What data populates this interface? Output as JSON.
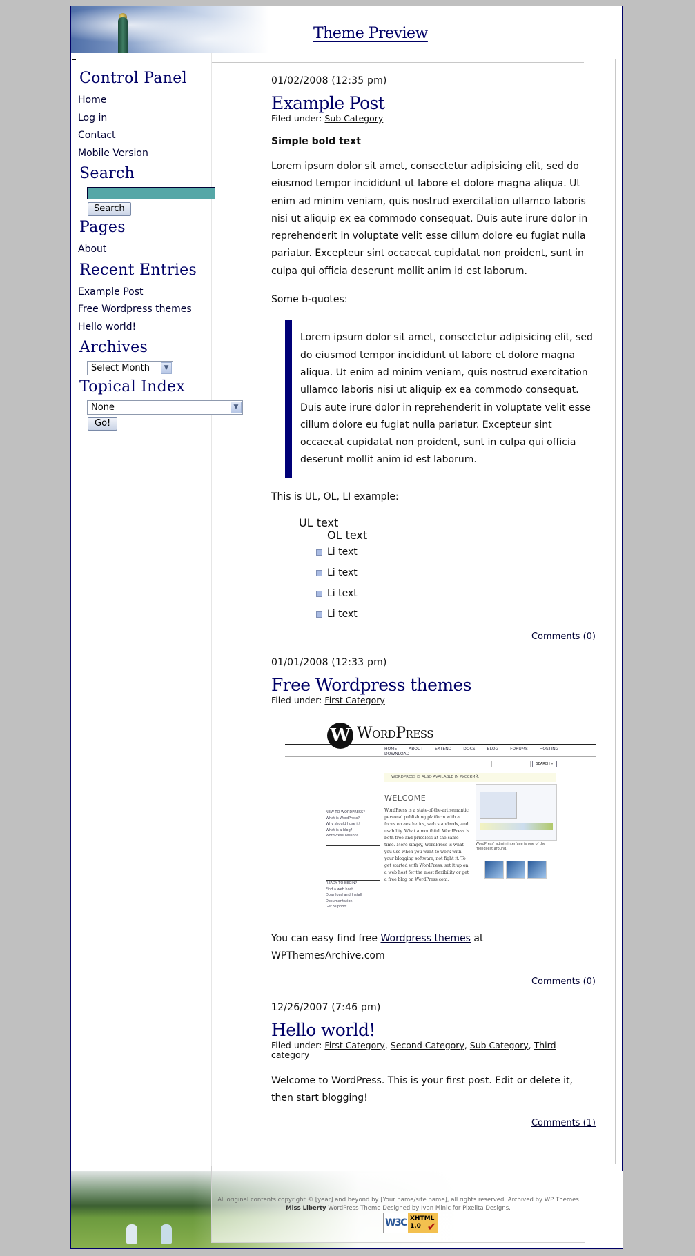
{
  "header": {
    "site_title": "Theme Preview"
  },
  "sidebar": {
    "control_panel": {
      "heading": "Control Panel",
      "links": [
        "Home",
        "Log in",
        "Contact",
        "Mobile Version"
      ]
    },
    "search": {
      "heading": "Search",
      "input_value": "",
      "button_label": "Search"
    },
    "pages": {
      "heading": "Pages",
      "links": [
        "About"
      ]
    },
    "recent_entries": {
      "heading": "Recent Entries",
      "links": [
        "Example Post",
        "Free Wordpress themes",
        "Hello world!"
      ]
    },
    "archives": {
      "heading": "Archives",
      "selected": "Select Month"
    },
    "topical_index": {
      "heading": "Topical Index",
      "selected": "None",
      "button_label": "Go!"
    }
  },
  "posts": [
    {
      "date": "01/02/2008 (12:35 pm)",
      "title": "Example Post",
      "filed_label": "Filed under:",
      "categories": [
        "Sub Category"
      ],
      "bold_text": "Simple bold text",
      "paragraph": "Lorem ipsum dolor sit amet, consectetur adipisicing elit, sed do eiusmod tempor incididunt ut labore et dolore magna aliqua. Ut enim ad minim veniam, quis nostrud exercitation ullamco laboris nisi ut aliquip ex ea commodo consequat. Duis aute irure dolor in reprehenderit in voluptate velit esse cillum dolore eu fugiat nulla pariatur. Excepteur sint occaecat cupidatat non proident, sunt in culpa qui officia deserunt mollit anim id est laborum.",
      "bquote_intro": "Some b-quotes:",
      "blockquote": "Lorem ipsum dolor sit amet, consectetur adipisicing elit, sed do eiusmod tempor incididunt ut labore et dolore magna aliqua. Ut enim ad minim veniam, quis nostrud exercitation ullamco laboris nisi ut aliquip ex ea commodo consequat. Duis aute irure dolor in reprehenderit in voluptate velit esse cillum dolore eu fugiat nulla pariatur. Excepteur sint occaecat cupidatat non proident, sunt in culpa qui officia deserunt mollit anim id est laborum.",
      "list_intro": "This is UL, OL, LI example:",
      "ul_text": "UL text",
      "ol_text": "OL text",
      "li_items": [
        "Li text",
        "Li text",
        "Li text",
        "Li text"
      ],
      "comments": "Comments (0)"
    },
    {
      "date": "01/01/2008 (12:33 pm)",
      "title": "Free Wordpress themes",
      "filed_label": "Filed under:",
      "categories": [
        "First Category"
      ],
      "image": {
        "logo_text": "WordPress",
        "nav": [
          "HOME",
          "ABOUT",
          "EXTEND",
          "DOCS",
          "BLOG",
          "FORUMS",
          "HOSTING",
          "DOWNLOAD"
        ],
        "search_button": "SEARCH »",
        "notice": "WORDPRESS IS ALSO AVAILABLE IN РУССКИЙ.",
        "welcome": "WELCOME",
        "body": "WordPress is a state-of-the-art semantic personal publishing platform with a focus on aesthetics, web standards, and usability. What a mouthful. WordPress is both free and priceless at the same time. More simply, WordPress is what you use when you want to work with your blogging software, not fight it. To get started with WordPress, set it up on a web host for the most flexibility or get a free blog on WordPress.com.",
        "side1_title": "NEW TO WORDPRESS?",
        "side1_items": [
          "What is WordPress?",
          "Why should I use it?",
          "What is a blog?",
          "WordPress Lessons"
        ],
        "side2_title": "READY TO BEGIN?",
        "side2_items": [
          "Find a web host",
          "Download and Install",
          "Documentation",
          "Get Support"
        ],
        "caption": "WordPress' admin interface is one of the friendliest around."
      },
      "text_before_link": "You can easy find free ",
      "link_text": "Wordpress themes",
      "text_after_link": " at WPThemesArchive.com",
      "comments": "Comments (0)"
    },
    {
      "date": "12/26/2007 (7:46 pm)",
      "title": "Hello world!",
      "filed_label": "Filed under:",
      "categories": [
        "First Category",
        "Second Category",
        "Sub Category",
        "Third category"
      ],
      "paragraph": "Welcome to WordPress. This is your first post. Edit or delete it, then start blogging!",
      "comments": "Comments (1)"
    }
  ],
  "footer": {
    "copyright": "All original contents copyright © [year] and beyond by [Your name/site name], all rights reserved. Archived by WP Themes",
    "theme_name": "Miss Liberty",
    "credit": " WordPress Theme Designed by Ivan Minic for Pixelita Designs.",
    "badge_w3c": "W3C",
    "badge_xhtml": "XHTML",
    "badge_version": "1.0"
  },
  "colors": {
    "heading": "#000066",
    "frame_border": "#000066",
    "page_background": "#c0c0c0",
    "blockquote_bar": "#000077",
    "search_field": "#55a7a7"
  }
}
